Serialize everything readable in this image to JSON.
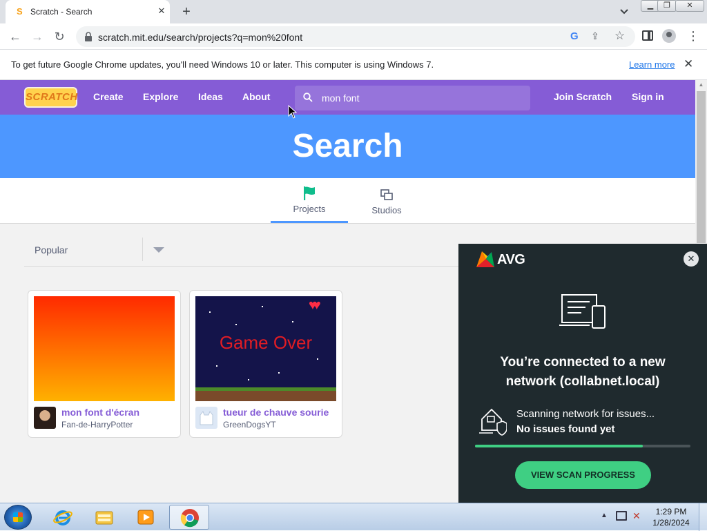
{
  "browser": {
    "tab_title": "Scratch - Search",
    "url": "scratch.mit.edu/search/projects?q=mon%20font",
    "infobar_text": "To get future Google Chrome updates, you'll need Windows 10 or later. This computer is using Windows 7.",
    "infobar_link": "Learn more"
  },
  "scratch_nav": {
    "logo_text": "SCRATCH",
    "links": [
      "Create",
      "Explore",
      "Ideas",
      "About"
    ],
    "search_value": "mon font",
    "join": "Join Scratch",
    "signin": "Sign in"
  },
  "banner": {
    "title": "Search"
  },
  "tabs": [
    {
      "label": "Projects",
      "active": true
    },
    {
      "label": "Studios",
      "active": false
    }
  ],
  "sort": {
    "selected": "Popular"
  },
  "projects": [
    {
      "title": "mon font d'écran",
      "author": "Fan-de-HarryPotter"
    },
    {
      "title": "tueur de chauve sourie",
      "author": "GreenDogsYT",
      "thumb_text": "Game Over"
    }
  ],
  "avg": {
    "brand": "AVG",
    "headline": "You’re connected to a new network (collabnet.local)",
    "scan_status": "Scanning network for issues...",
    "scan_result": "No issues found yet",
    "progress": 0.78,
    "button": "VIEW SCAN PROGRESS",
    "accent": "#3fcf83"
  },
  "taskbar": {
    "time": "1:29 PM",
    "date": "1/28/2024",
    "apps": [
      "internet-explorer-icon",
      "file-explorer-icon",
      "media-player-icon",
      "chrome-icon"
    ]
  }
}
